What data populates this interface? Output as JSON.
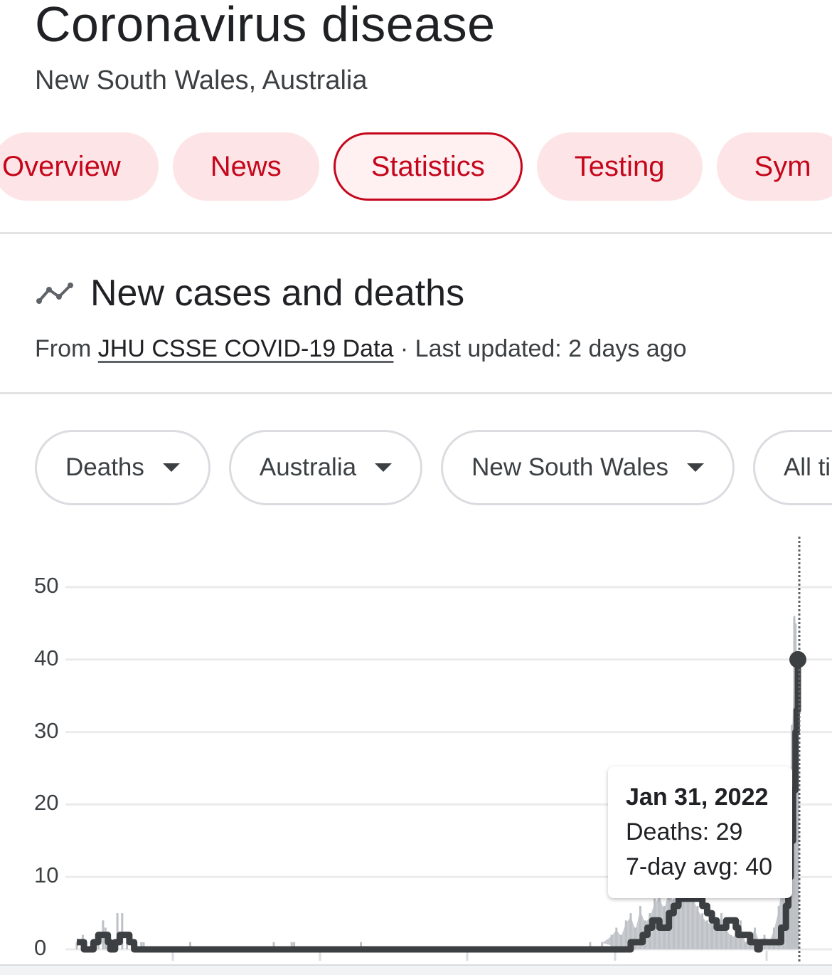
{
  "header": {
    "title": "Coronavirus disease",
    "subtitle": "New South Wales, Australia"
  },
  "tabs": [
    {
      "label": "Overview",
      "active": false
    },
    {
      "label": "News",
      "active": false
    },
    {
      "label": "Statistics",
      "active": true
    },
    {
      "label": "Testing",
      "active": false
    },
    {
      "label": "Sym",
      "active": false
    }
  ],
  "section": {
    "icon": "trending-line-icon",
    "title": "New cases and deaths",
    "source_prefix": "From ",
    "source_link": "JHU CSSE COVID-19 Data",
    "updated": " · Last updated: 2 days ago"
  },
  "filters": [
    {
      "label": "Deaths",
      "icon": "caret-down-icon"
    },
    {
      "label": "Australia",
      "icon": "caret-down-icon"
    },
    {
      "label": "New South Wales",
      "icon": "caret-down-icon"
    },
    {
      "label": "All tir",
      "icon": "caret-down-icon"
    }
  ],
  "colors": {
    "accent": "#c5061b",
    "accent_bg": "#fde5e7",
    "line": "#3c4043",
    "bars": "#bdc1c6",
    "grid": "#ebebeb"
  },
  "tooltip": {
    "date": "Jan 31, 2022",
    "deaths_line": "Deaths: 29",
    "avg_line": "7-day avg: 40"
  },
  "chart_data": {
    "type": "bar",
    "title": "New cases and deaths",
    "xlabel": "",
    "ylabel": "Deaths",
    "ylim": [
      0,
      55
    ],
    "yticks": [
      "0",
      "10",
      "20",
      "30",
      "40",
      "50"
    ],
    "grid": true,
    "legend": "none",
    "x_note": "daily index from start of series to Jan 31, 2022 (last point)",
    "series": [
      {
        "name": "Deaths (daily)",
        "kind": "bar",
        "points": [
          [
            0,
            1
          ],
          [
            5,
            2
          ],
          [
            12,
            1
          ],
          [
            18,
            1
          ],
          [
            22,
            4
          ],
          [
            24,
            3
          ],
          [
            28,
            1
          ],
          [
            34,
            5
          ],
          [
            38,
            5
          ],
          [
            42,
            1
          ],
          [
            50,
            1
          ],
          [
            54,
            1
          ],
          [
            56,
            1
          ],
          [
            95,
            1
          ],
          [
            165,
            1
          ],
          [
            180,
            1
          ],
          [
            182,
            1
          ],
          [
            238,
            1
          ],
          [
            430,
            1
          ],
          [
            440,
            1
          ],
          [
            448,
            2
          ],
          [
            452,
            3
          ],
          [
            456,
            2
          ],
          [
            460,
            4
          ],
          [
            464,
            5
          ],
          [
            468,
            3
          ],
          [
            472,
            6
          ],
          [
            476,
            4
          ],
          [
            480,
            5
          ],
          [
            484,
            7
          ],
          [
            488,
            8
          ],
          [
            492,
            6
          ],
          [
            496,
            9
          ],
          [
            500,
            7
          ],
          [
            504,
            8
          ],
          [
            508,
            9
          ],
          [
            512,
            7
          ],
          [
            516,
            8
          ],
          [
            520,
            6
          ],
          [
            524,
            5
          ],
          [
            528,
            4
          ],
          [
            532,
            4
          ],
          [
            536,
            3
          ],
          [
            540,
            5
          ],
          [
            544,
            3
          ],
          [
            548,
            2
          ],
          [
            552,
            2
          ],
          [
            556,
            4
          ],
          [
            560,
            1
          ],
          [
            564,
            2
          ],
          [
            568,
            3
          ],
          [
            572,
            1
          ],
          [
            576,
            2
          ],
          [
            580,
            1
          ],
          [
            584,
            3
          ],
          [
            588,
            6
          ],
          [
            592,
            12
          ],
          [
            595,
            16
          ],
          [
            597,
            25
          ],
          [
            599,
            31
          ],
          [
            601,
            46
          ],
          [
            602,
            45
          ],
          [
            604,
            29
          ]
        ]
      },
      {
        "name": "7-day avg",
        "kind": "line",
        "points": [
          [
            0,
            1
          ],
          [
            4,
            1
          ],
          [
            6,
            0
          ],
          [
            10,
            0
          ],
          [
            14,
            1
          ],
          [
            18,
            2
          ],
          [
            22,
            2
          ],
          [
            26,
            1
          ],
          [
            28,
            0
          ],
          [
            32,
            1
          ],
          [
            36,
            2
          ],
          [
            40,
            2
          ],
          [
            44,
            1
          ],
          [
            48,
            0
          ],
          [
            460,
            0
          ],
          [
            464,
            1
          ],
          [
            470,
            1
          ],
          [
            474,
            2
          ],
          [
            478,
            3
          ],
          [
            482,
            4
          ],
          [
            486,
            4
          ],
          [
            488,
            3
          ],
          [
            492,
            3
          ],
          [
            496,
            5
          ],
          [
            500,
            6
          ],
          [
            504,
            7
          ],
          [
            508,
            7
          ],
          [
            512,
            7
          ],
          [
            516,
            7
          ],
          [
            520,
            7
          ],
          [
            524,
            6
          ],
          [
            528,
            5
          ],
          [
            532,
            4
          ],
          [
            536,
            3
          ],
          [
            540,
            3
          ],
          [
            544,
            4
          ],
          [
            548,
            4
          ],
          [
            552,
            3
          ],
          [
            554,
            2
          ],
          [
            560,
            2
          ],
          [
            564,
            1
          ],
          [
            568,
            1
          ],
          [
            570,
            0
          ],
          [
            572,
            1
          ],
          [
            580,
            1
          ],
          [
            586,
            1
          ],
          [
            590,
            3
          ],
          [
            594,
            6
          ],
          [
            596,
            10
          ],
          [
            598,
            15
          ],
          [
            600,
            22
          ],
          [
            602,
            30
          ],
          [
            603,
            33
          ],
          [
            604,
            40
          ]
        ]
      }
    ],
    "highlight": {
      "date": "Jan 31, 2022",
      "deaths": 29,
      "avg_7day": 40
    }
  }
}
